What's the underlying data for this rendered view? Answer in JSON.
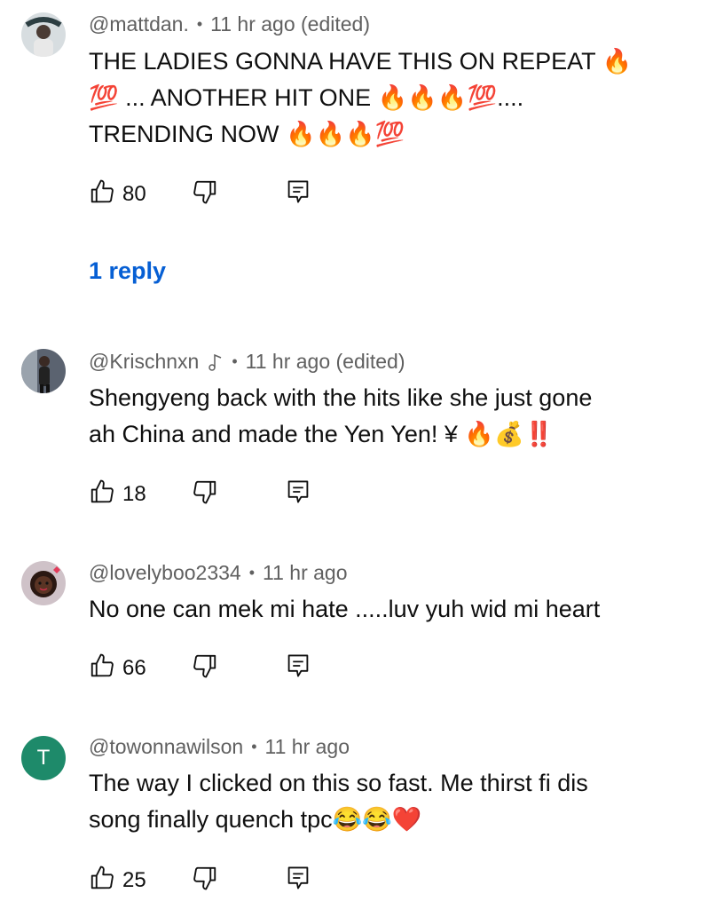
{
  "comments": [
    {
      "handle": "@mattdan.",
      "time": "11 hr ago (edited)",
      "lines": [
        "THE LADIES GONNA HAVE THIS ON REPEAT 🔥",
        "💯 ... ANOTHER HIT ONE 🔥🔥🔥💯....",
        "TRENDING NOW 🔥🔥🔥💯"
      ],
      "likes": "80",
      "replies": "1 reply",
      "avatar": "photo"
    },
    {
      "handle": "@Krischnxn",
      "music_note_icon": "music-note-icon",
      "time": "11 hr ago (edited)",
      "lines": [
        "Shengyeng back with the hits like she just gone",
        "ah China and made the Yen Yen! ¥ 🔥💰‼️"
      ],
      "likes": "18",
      "avatar": "photo"
    },
    {
      "handle": "@lovelyboo2334",
      "time": "11 hr ago",
      "lines": [
        "No one can mek mi hate .....luv yuh wid mi heart"
      ],
      "likes": "66",
      "avatar": "photo"
    },
    {
      "handle": "@towonnawilson",
      "time": "11 hr ago",
      "lines": [
        "The way I clicked on this so fast. Me thirst fi dis",
        "song finally quench tpc😂😂❤️"
      ],
      "likes": "25",
      "avatar_letter": "T",
      "avatar_color": "#1e8a6a"
    }
  ],
  "icons": {
    "like": "thumbs-up-outline-icon",
    "dislike": "thumbs-down-outline-icon",
    "reply": "reply-comment-icon"
  },
  "colors": {
    "link": "#065fd4",
    "meta": "#606060",
    "text": "#0f0f0f"
  }
}
